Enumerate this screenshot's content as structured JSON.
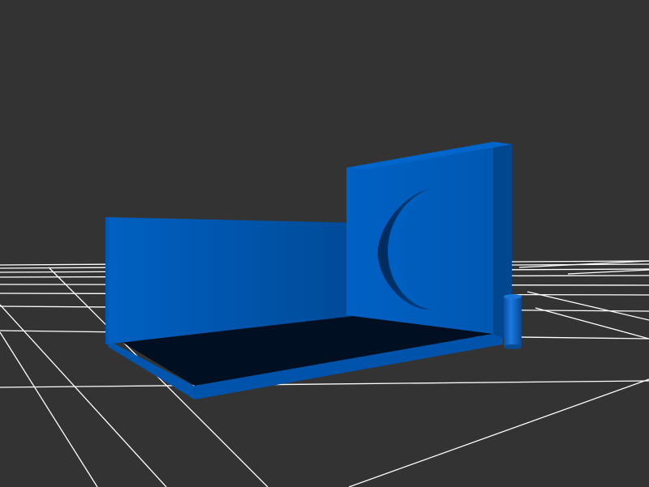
{
  "scene": {
    "background_color": "#333333",
    "grid_color": "#ffffff",
    "model_color": "#0060c0",
    "model_dark_color": "#00468e",
    "floor_color": "#000f22",
    "objects": [
      "ground-grid",
      "base-plate",
      "left-wall",
      "right-wall-with-slot",
      "cylinder-post"
    ]
  }
}
